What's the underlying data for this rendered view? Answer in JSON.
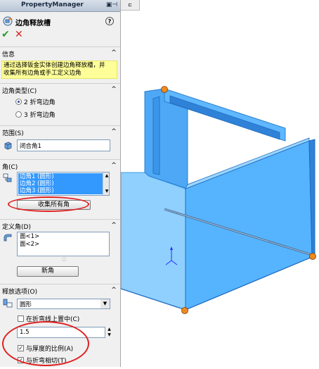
{
  "panel": {
    "title": "PropertyManager",
    "feature_title": "边角释放槽",
    "help": "?",
    "ok": "✔",
    "cancel": "✕",
    "pin": "▣⊣"
  },
  "sections": {
    "info": {
      "label": "信息",
      "text_line1": "通过选择钣金实体创建边角释放槽，并",
      "text_line2": "收集所有边角或手工定义边角"
    },
    "corner_type": {
      "label": "边角类型(C)",
      "options": [
        "2 折弯边角",
        "3 折弯边角"
      ],
      "selected_index": 0
    },
    "scope": {
      "label": "范围(S)",
      "value": "闭合角1"
    },
    "corner": {
      "label": "角(C)",
      "items": [
        "边角1 (圆形)",
        "边角2 (圆形)",
        "边角3 (圆形)"
      ],
      "collect_button": "收集所有角"
    },
    "define_corner": {
      "label": "定义角(D)",
      "items": [
        "面<1>",
        "面<2>"
      ],
      "new_button": "新角"
    },
    "relief_options": {
      "label": "释放选项(O)",
      "shape": "圆形",
      "centered_label": "在折弯线上置中(C)",
      "centered_checked": false,
      "value": "1.5",
      "ratio_label": "与厚度的比例(A)",
      "ratio_checked": true,
      "tangent_label": "与折弯相切(T)",
      "tangent_checked": true
    }
  },
  "chevron": "^",
  "colors": {
    "info_bg": "#ffff99",
    "selection": "#3399ff",
    "part_blue": "#56b4ff",
    "highlight_red": "#e02020",
    "vertex_orange": "#f08a1d"
  }
}
